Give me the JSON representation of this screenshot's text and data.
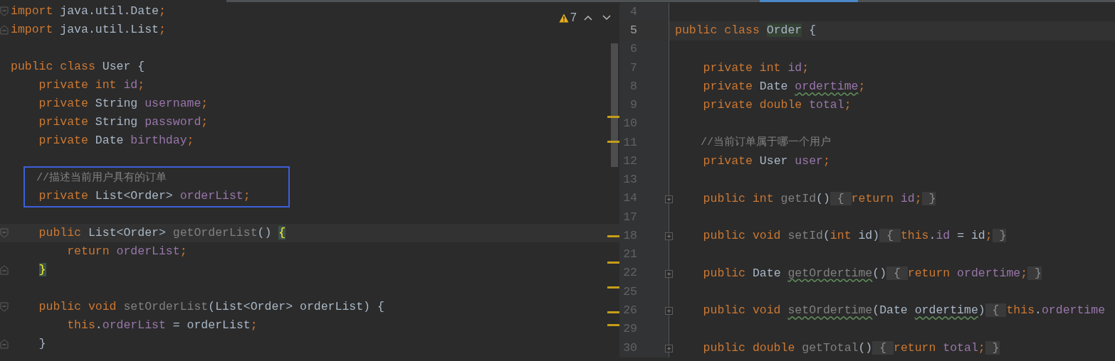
{
  "left_editor": {
    "inspection_widget": {
      "warnings": "7"
    },
    "blocks": [
      {
        "lines": [
          {
            "fold_start": true,
            "tokens": [
              {
                "kind": "kw",
                "text": "import "
              },
              {
                "kind": "plain",
                "text": "java.util.Date"
              },
              {
                "kind": "kw",
                "text": ";"
              }
            ]
          },
          {
            "fold_end": true,
            "tokens": [
              {
                "kind": "kw",
                "text": "import "
              },
              {
                "kind": "plain",
                "text": "java.util.List"
              },
              {
                "kind": "kw",
                "text": ";"
              }
            ]
          }
        ]
      },
      {
        "lines": [
          {
            "tokens": [
              {
                "kind": "kw",
                "text": "public class "
              },
              {
                "kind": "plain",
                "text": "User {"
              }
            ]
          },
          {
            "tokens": [
              {
                "kind": "kw",
                "text": "    private int "
              },
              {
                "kind": "field",
                "text": "id"
              },
              {
                "kind": "kw",
                "text": ";"
              }
            ]
          },
          {
            "tokens": [
              {
                "kind": "kw",
                "text": "    private "
              },
              {
                "kind": "plain",
                "text": "String "
              },
              {
                "kind": "field",
                "text": "username"
              },
              {
                "kind": "kw",
                "text": ";"
              }
            ]
          },
          {
            "tokens": [
              {
                "kind": "kw",
                "text": "    private "
              },
              {
                "kind": "plain",
                "text": "String "
              },
              {
                "kind": "field",
                "text": "password"
              },
              {
                "kind": "kw",
                "text": ";"
              }
            ]
          },
          {
            "tokens": [
              {
                "kind": "kw",
                "text": "    private "
              },
              {
                "kind": "plain",
                "text": "Date "
              },
              {
                "kind": "field",
                "text": "birthday"
              },
              {
                "kind": "kw",
                "text": ";"
              }
            ]
          }
        ]
      },
      {
        "boxed": true,
        "lines": [
          {
            "tokens": [
              {
                "kind": "comment",
                "text": "    //描述当前用户具有的订单"
              }
            ]
          },
          {
            "tokens": [
              {
                "kind": "kw",
                "text": "    private "
              },
              {
                "kind": "plain",
                "text": "List<Order> "
              },
              {
                "kind": "field",
                "text": "orderList"
              },
              {
                "kind": "kw",
                "text": ";"
              }
            ]
          }
        ]
      },
      {
        "lines": [
          {
            "current": true,
            "fold_start": true,
            "tokens": [
              {
                "kind": "kw",
                "text": "    public "
              },
              {
                "kind": "plain",
                "text": "List<Order> "
              },
              {
                "kind": "method",
                "text": "getOrderList"
              },
              {
                "kind": "plain",
                "text": "() "
              },
              {
                "kind": "match",
                "text": "{"
              }
            ]
          },
          {
            "tokens": [
              {
                "kind": "kw",
                "text": "        return "
              },
              {
                "kind": "field",
                "text": "orderList"
              },
              {
                "kind": "kw",
                "text": ";"
              }
            ]
          },
          {
            "fold_end": true,
            "tokens": [
              {
                "kind": "match",
                "text": "    }"
              }
            ]
          }
        ]
      },
      {
        "lines": [
          {
            "fold_start": true,
            "tokens": [
              {
                "kind": "kw",
                "text": "    public void "
              },
              {
                "kind": "method",
                "text": "setOrderList"
              },
              {
                "kind": "plain",
                "text": "(List<Order> orderList) {"
              }
            ]
          },
          {
            "tokens": [
              {
                "kind": "kw",
                "text": "        this"
              },
              {
                "kind": "plain",
                "text": "."
              },
              {
                "kind": "field",
                "text": "orderList"
              },
              {
                "kind": "plain",
                "text": " = orderList"
              },
              {
                "kind": "kw",
                "text": ";"
              }
            ]
          },
          {
            "fold_end": true,
            "tokens": [
              {
                "kind": "plain",
                "text": "    }"
              }
            ]
          }
        ]
      }
    ]
  },
  "right_editor": {
    "lines": [
      {
        "number": "4"
      },
      {
        "number": "5",
        "current": true,
        "tokens": [
          {
            "kind": "kw",
            "text": "public class "
          },
          {
            "kind": "classdecl",
            "text": "Order"
          },
          {
            "kind": "plain",
            "text": " {"
          }
        ]
      },
      {
        "number": "6"
      },
      {
        "number": "7",
        "tokens": [
          {
            "kind": "kw",
            "text": "    private int "
          },
          {
            "kind": "field",
            "text": "id"
          },
          {
            "kind": "kw",
            "text": ";"
          }
        ]
      },
      {
        "number": "8",
        "tokens": [
          {
            "kind": "kw",
            "text": "    private "
          },
          {
            "kind": "plain",
            "text": "Date "
          },
          {
            "kind": "field",
            "text": "ordertime",
            "warning": true
          },
          {
            "kind": "kw",
            "text": ";"
          }
        ]
      },
      {
        "number": "9",
        "tokens": [
          {
            "kind": "kw",
            "text": "    private double "
          },
          {
            "kind": "field",
            "text": "total"
          },
          {
            "kind": "kw",
            "text": ";"
          }
        ]
      },
      {
        "number": "10"
      },
      {
        "number": "11",
        "tokens": [
          {
            "kind": "comment",
            "text": "    //当前订单属于哪一个用户"
          }
        ]
      },
      {
        "number": "12",
        "tokens": [
          {
            "kind": "kw",
            "text": "    private "
          },
          {
            "kind": "plain",
            "text": "User "
          },
          {
            "kind": "field",
            "text": "user"
          },
          {
            "kind": "kw",
            "text": ";"
          }
        ]
      },
      {
        "number": "13"
      },
      {
        "number": "14",
        "collapsed": true,
        "tokens": [
          {
            "kind": "kw",
            "text": "    public int "
          },
          {
            "kind": "method",
            "text": "getId"
          },
          {
            "kind": "plain",
            "text": "()"
          },
          {
            "kind": "folded",
            "text": " { "
          },
          {
            "kind": "kw",
            "text": "return "
          },
          {
            "kind": "field",
            "text": "id"
          },
          {
            "kind": "kw",
            "text": ";"
          },
          {
            "kind": "folded",
            "text": " }"
          }
        ]
      },
      {
        "number": "17"
      },
      {
        "number": "18",
        "collapsed": true,
        "tokens": [
          {
            "kind": "kw",
            "text": "    public void "
          },
          {
            "kind": "method",
            "text": "setId"
          },
          {
            "kind": "plain",
            "text": "("
          },
          {
            "kind": "kw",
            "text": "int "
          },
          {
            "kind": "plain",
            "text": "id)"
          },
          {
            "kind": "folded",
            "text": " { "
          },
          {
            "kind": "kw",
            "text": "this"
          },
          {
            "kind": "plain",
            "text": "."
          },
          {
            "kind": "field",
            "text": "id"
          },
          {
            "kind": "plain",
            "text": " = id"
          },
          {
            "kind": "kw",
            "text": ";"
          },
          {
            "kind": "folded",
            "text": " }"
          }
        ]
      },
      {
        "number": "21"
      },
      {
        "number": "22",
        "collapsed": true,
        "tokens": [
          {
            "kind": "kw",
            "text": "    public "
          },
          {
            "kind": "plain",
            "text": "Date "
          },
          {
            "kind": "method",
            "text": "getOrdertime",
            "warning": true
          },
          {
            "kind": "plain",
            "text": "()"
          },
          {
            "kind": "folded",
            "text": " { "
          },
          {
            "kind": "kw",
            "text": "return "
          },
          {
            "kind": "field",
            "text": "ordertime"
          },
          {
            "kind": "kw",
            "text": ";"
          },
          {
            "kind": "folded",
            "text": " }"
          }
        ]
      },
      {
        "number": "25"
      },
      {
        "number": "26",
        "collapsed": true,
        "tokens": [
          {
            "kind": "kw",
            "text": "    public void "
          },
          {
            "kind": "method",
            "text": "setOrdertime",
            "warning": true
          },
          {
            "kind": "plain",
            "text": "(Date "
          },
          {
            "kind": "plain",
            "text": "ordertime",
            "warning": true
          },
          {
            "kind": "plain",
            "text": ")"
          },
          {
            "kind": "folded",
            "text": " { "
          },
          {
            "kind": "kw",
            "text": "this"
          },
          {
            "kind": "plain",
            "text": "."
          },
          {
            "kind": "field",
            "text": "ordertime"
          }
        ]
      },
      {
        "number": "29"
      },
      {
        "number": "30",
        "collapsed": true,
        "tokens": [
          {
            "kind": "kw",
            "text": "    public double "
          },
          {
            "kind": "method",
            "text": "getTotal"
          },
          {
            "kind": "plain",
            "text": "()"
          },
          {
            "kind": "folded",
            "text": " { "
          },
          {
            "kind": "kw",
            "text": "return "
          },
          {
            "kind": "field",
            "text": "total"
          },
          {
            "kind": "kw",
            "text": ";"
          },
          {
            "kind": "folded",
            "text": " }"
          }
        ]
      }
    ]
  }
}
